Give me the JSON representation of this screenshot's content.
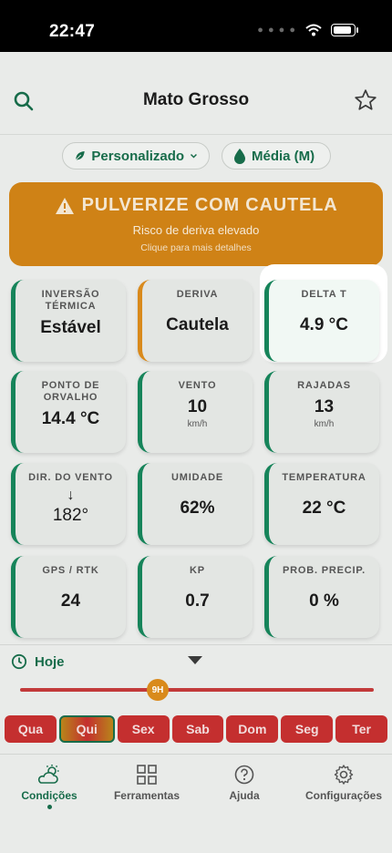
{
  "status_bar": {
    "time": "22:47",
    "battery_level": 0.9
  },
  "header": {
    "title": "Mato Grosso"
  },
  "filters": {
    "preset": "Personalizado",
    "average": "Média (M)"
  },
  "warning": {
    "title": "PULVERIZE COM CAUTELA",
    "subtitle": "Risco de deriva elevado",
    "hint": "Clique para mais detalhes"
  },
  "metrics": [
    {
      "label": "INVERSÃO TÉRMICA",
      "value": "Estável",
      "unit": ""
    },
    {
      "label": "DERIVA",
      "value": "Cautela",
      "unit": ""
    },
    {
      "label": "DELTA T",
      "value": "4.9 °C",
      "unit": ""
    },
    {
      "label": "PONTO DE ORVALHO",
      "value": "14.4 °C",
      "unit": ""
    },
    {
      "label": "VENTO",
      "value": "10",
      "unit": "km/h"
    },
    {
      "label": "RAJADAS",
      "value": "13",
      "unit": "km/h"
    },
    {
      "label": "DIR. DO VENTO",
      "value": "182°",
      "arrow": "↓"
    },
    {
      "label": "UMIDADE",
      "value": "62%",
      "unit": ""
    },
    {
      "label": "TEMPERATURA",
      "value": "22 °C",
      "unit": ""
    },
    {
      "label": "GPS / RTK",
      "value": "24",
      "unit": ""
    },
    {
      "label": "KP",
      "value": "0.7",
      "unit": ""
    },
    {
      "label": "PROB. PRECIP.",
      "value": "0 %",
      "unit": ""
    }
  ],
  "timeline": {
    "label": "Hoje",
    "thumb": "9H"
  },
  "days": [
    "Qua",
    "Qui",
    "Sex",
    "Sab",
    "Dom",
    "Seg",
    "Ter"
  ],
  "nav": {
    "conditions": "Condições",
    "tools": "Ferramentas",
    "help": "Ajuda",
    "settings": "Configurações"
  },
  "colors": {
    "accent": "#176c4a",
    "warning": "#cf8216",
    "danger": "#c42f2f"
  }
}
